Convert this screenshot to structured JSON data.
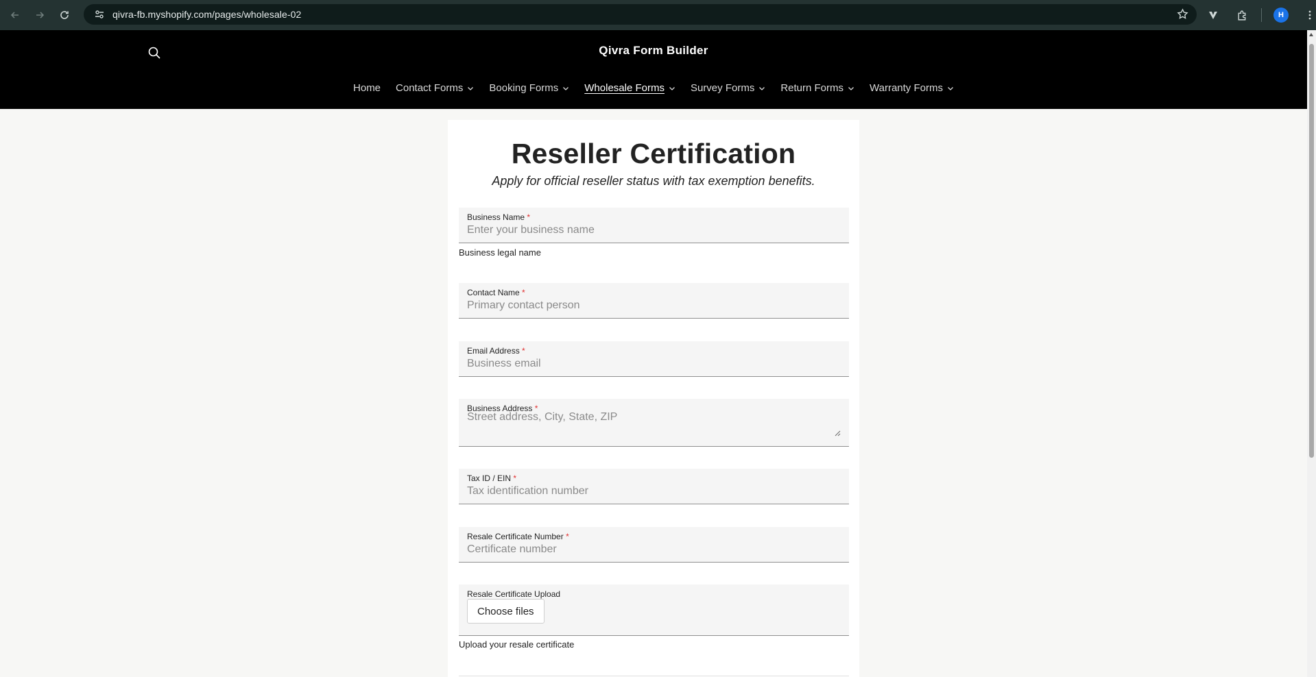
{
  "browser": {
    "url": "qivra-fb.myshopify.com/pages/wholesale-02",
    "profile_initial": "H"
  },
  "header": {
    "brand": "Qivra Form Builder",
    "nav": [
      {
        "label": "Home",
        "dropdown": false,
        "active": false
      },
      {
        "label": "Contact Forms",
        "dropdown": true,
        "active": false
      },
      {
        "label": "Booking Forms",
        "dropdown": true,
        "active": false
      },
      {
        "label": "Wholesale Forms",
        "dropdown": true,
        "active": true
      },
      {
        "label": "Survey Forms",
        "dropdown": true,
        "active": false
      },
      {
        "label": "Return Forms",
        "dropdown": true,
        "active": false
      },
      {
        "label": "Warranty Forms",
        "dropdown": true,
        "active": false
      }
    ]
  },
  "form": {
    "title": "Reseller Certification",
    "subtitle": "Apply for official reseller status with tax exemption benefits.",
    "required_mark": "*",
    "fields": {
      "business_name": {
        "label": "Business Name",
        "placeholder": "Enter your business name",
        "help": "Business legal name"
      },
      "contact_name": {
        "label": "Contact Name",
        "placeholder": "Primary contact person"
      },
      "email": {
        "label": "Email Address",
        "placeholder": "Business email"
      },
      "address": {
        "label": "Business Address",
        "placeholder": "Street address, City, State, ZIP"
      },
      "tax_id": {
        "label": "Tax ID / EIN",
        "placeholder": "Tax identification number"
      },
      "certificate_number": {
        "label": "Resale Certificate Number",
        "placeholder": "Certificate number"
      },
      "certificate_upload": {
        "label": "Resale Certificate Upload",
        "button": "Choose files",
        "help": "Upload your resale certificate"
      }
    }
  },
  "colors": {
    "chrome_bg": "#243332",
    "header_bg": "#000000",
    "page_bg": "#f7f7f5",
    "required": "#e03030"
  }
}
